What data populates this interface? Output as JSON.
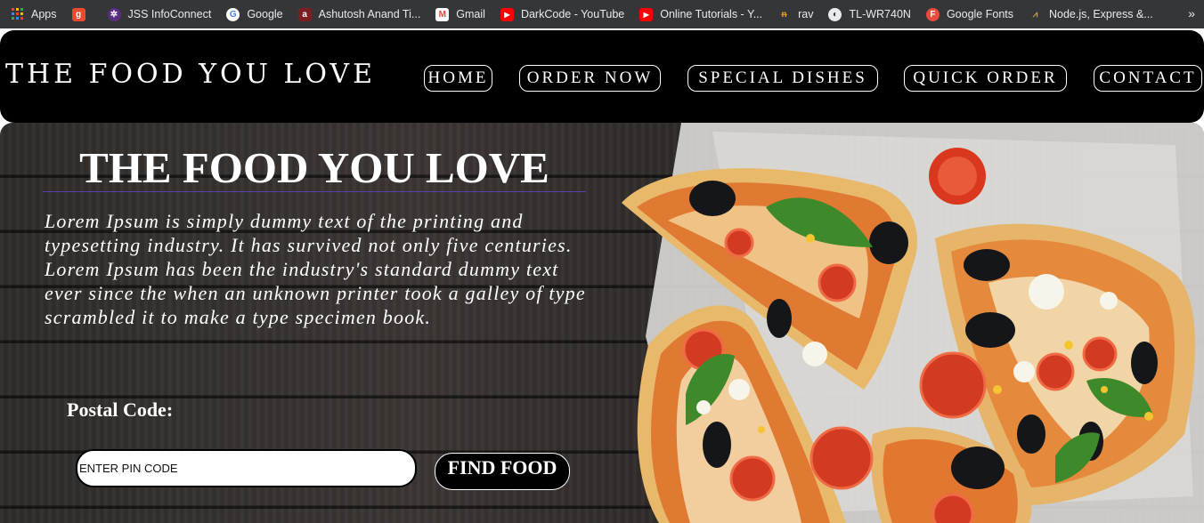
{
  "bookmarks": [
    {
      "label": "Apps",
      "icon": "apps-grid-icon",
      "color": "#e8eaed"
    },
    {
      "label": "",
      "icon": "g-logo-icon",
      "color": "#e94b2b"
    },
    {
      "label": "JSS InfoConnect",
      "icon": "jss-icon",
      "color": "#7b3fb0"
    },
    {
      "label": "Google",
      "icon": "google-icon",
      "color": "#ffffff"
    },
    {
      "label": "Ashutosh Anand Ti...",
      "icon": "bookmark-icon",
      "color": "#c0392b"
    },
    {
      "label": "Gmail",
      "icon": "gmail-icon",
      "color": "#ea4335"
    },
    {
      "label": "DarkCode - YouTube",
      "icon": "youtube-icon",
      "color": "#ff0000"
    },
    {
      "label": "Online Tutorials - Y...",
      "icon": "youtube-icon",
      "color": "#ff0000"
    },
    {
      "label": "rav",
      "icon": "rav-icon",
      "color": "#f39c12"
    },
    {
      "label": "TL-WR740N",
      "icon": "globe-icon",
      "color": "#e8eaed"
    },
    {
      "label": "Google Fonts",
      "icon": "google-fonts-icon",
      "color": "#e94b3c"
    },
    {
      "label": "Node.js, Express &...",
      "icon": "nodejs-icon",
      "color": "#c8a14a"
    }
  ],
  "bookmarks_more": "»",
  "header": {
    "logo": "THE FOOD YOU LOVE",
    "nav": [
      "HOME",
      "ORDER NOW",
      "SPECIAL DISHES",
      "QUICK ORDER",
      "CONTACT"
    ]
  },
  "hero": {
    "title": "THE FOOD YOU LOVE",
    "description": "Lorem Ipsum is simply dummy text of the printing and typesetting industry. It has survived not only five centuries. Lorem Ipsum has been the industry's standard dummy text ever since the when an unknown printer took a galley of type scrambled it to make a type specimen book.",
    "postal_label": "Postal Code:",
    "pin_placeholder": "ENTER PIN CODE",
    "find_button": "FIND FOOD"
  },
  "colors": {
    "header_bg": "#000000",
    "title_underline": "#5b3fb0",
    "bookmark_bar_bg": "#35363a"
  }
}
